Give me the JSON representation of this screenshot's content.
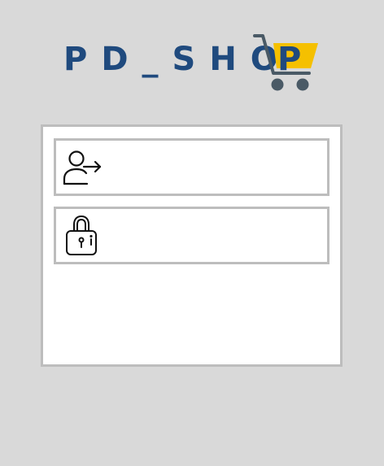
{
  "logo": {
    "text": "PD_SHO",
    "last_letter": "P",
    "text_color": "#1f4a7e",
    "cart_color": "#4a5a66",
    "cart_accent": "#f5c000"
  },
  "login": {
    "username": {
      "icon": "user-login-icon",
      "value": "",
      "placeholder": ""
    },
    "password": {
      "icon": "lock-icon",
      "value": "",
      "placeholder": ""
    }
  },
  "colors": {
    "background": "#d9d9d9",
    "panel": "#ffffff",
    "border": "#bdbdbd"
  }
}
